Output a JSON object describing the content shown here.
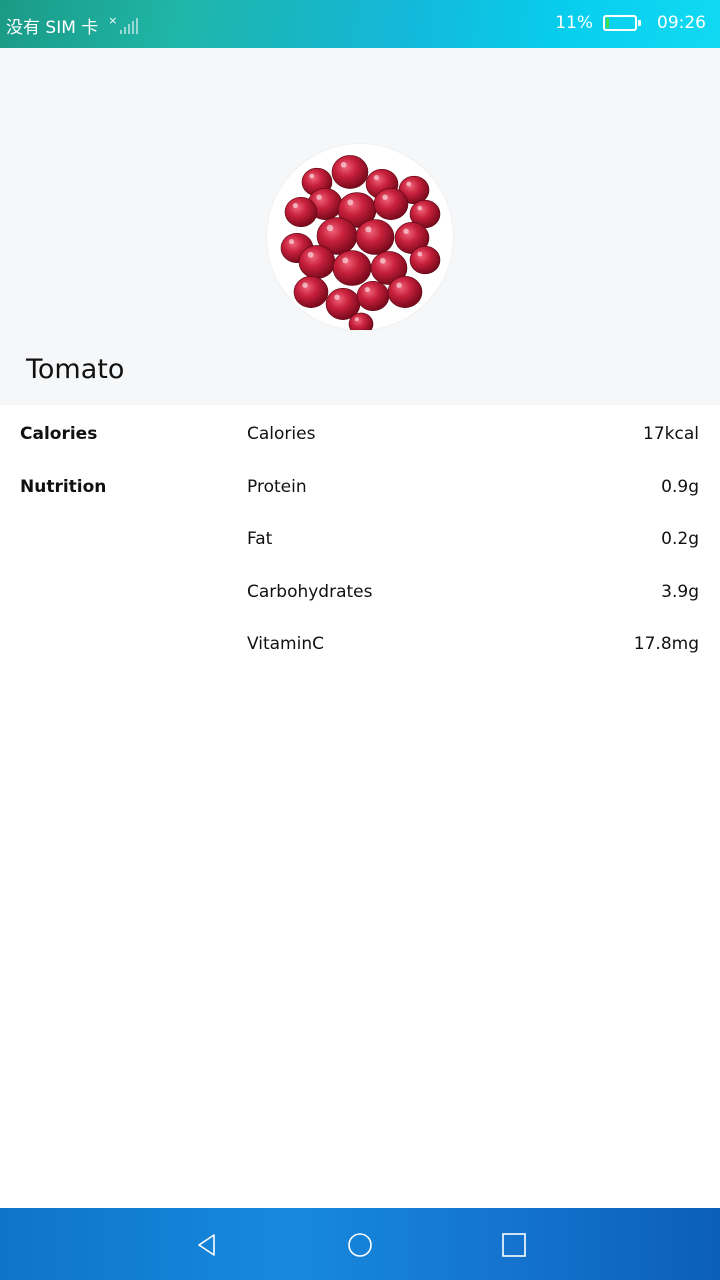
{
  "status_bar": {
    "carrier": "没有 SIM 卡",
    "no_sim_mark": "×",
    "battery_percent": "11%",
    "battery_level": 0.11,
    "time": "09:26"
  },
  "food": {
    "name": "Tomato",
    "image_icon": "cranberries-bowl-photo"
  },
  "sections": [
    {
      "label": "Calories",
      "rows": [
        {
          "name": "Calories",
          "value": "17kcal"
        }
      ]
    },
    {
      "label": "Nutrition",
      "rows": [
        {
          "name": "Protein",
          "value": "0.9g"
        },
        {
          "name": "Fat",
          "value": "0.2g"
        },
        {
          "name": "Carbohydrates",
          "value": "3.9g"
        },
        {
          "name": "VitaminC",
          "value": "17.8mg"
        }
      ]
    }
  ],
  "nav_bar": {
    "back_icon": "triangle-back-icon",
    "home_icon": "circle-home-icon",
    "recents_icon": "square-recents-icon"
  },
  "colors": {
    "battery_fill": "#3fe04a",
    "header_bg": "#f6f7f9"
  }
}
